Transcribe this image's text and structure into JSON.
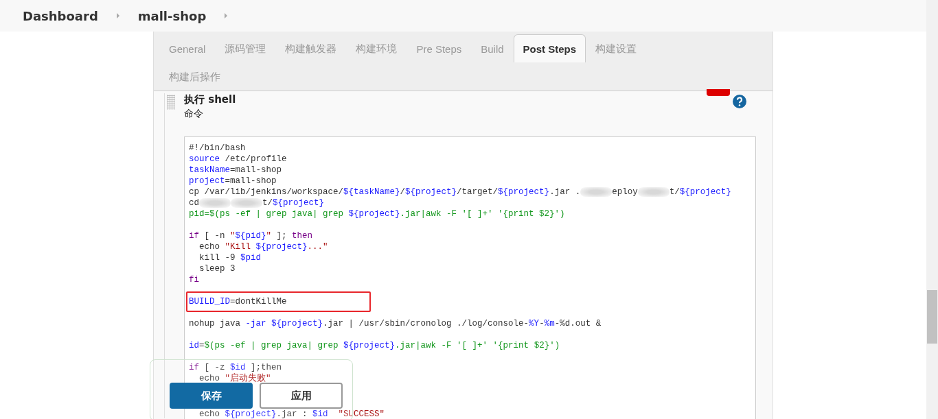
{
  "breadcrumbs": [
    {
      "label": "Dashboard"
    },
    {
      "label": "mall-shop"
    }
  ],
  "tabs": [
    {
      "label": "General",
      "selected": false
    },
    {
      "label": "源码管理",
      "selected": false
    },
    {
      "label": "构建触发器",
      "selected": false
    },
    {
      "label": "构建环境",
      "selected": false
    },
    {
      "label": "Pre Steps",
      "selected": false
    },
    {
      "label": "Build",
      "selected": false
    },
    {
      "label": "Post Steps",
      "selected": true
    },
    {
      "label": "构建设置",
      "selected": false
    },
    {
      "label": "构建后操作",
      "selected": false
    }
  ],
  "section": {
    "title": "执行 shell",
    "field_label": "命令"
  },
  "code_lines": [
    {
      "blank_before": false,
      "highlighted": false,
      "tokens": [
        {
          "kind": "plain",
          "text": "#!/bin/bash"
        }
      ]
    },
    {
      "blank_before": false,
      "highlighted": false,
      "tokens": [
        {
          "kind": "var",
          "text": "source"
        },
        {
          "kind": "plain",
          "text": " /etc/profile"
        }
      ]
    },
    {
      "blank_before": false,
      "highlighted": false,
      "tokens": [
        {
          "kind": "var",
          "text": "taskName"
        },
        {
          "kind": "plain",
          "text": "=mall-shop"
        }
      ]
    },
    {
      "blank_before": false,
      "highlighted": false,
      "tokens": [
        {
          "kind": "var",
          "text": "project"
        },
        {
          "kind": "plain",
          "text": "=mall-shop"
        }
      ]
    },
    {
      "blank_before": false,
      "highlighted": false,
      "tokens": [
        {
          "kind": "plain",
          "text": "cp /var/lib/jenkins/workspace/"
        },
        {
          "kind": "var",
          "text": "${taskName}"
        },
        {
          "kind": "plain",
          "text": "/"
        },
        {
          "kind": "var",
          "text": "${project}"
        },
        {
          "kind": "plain",
          "text": "/target/"
        },
        {
          "kind": "var",
          "text": "${project}"
        },
        {
          "kind": "plain",
          "text": ".jar ."
        },
        {
          "kind": "redacted"
        },
        {
          "kind": "plain",
          "text": "eploy"
        },
        {
          "kind": "redacted"
        },
        {
          "kind": "plain",
          "text": "t/"
        },
        {
          "kind": "var",
          "text": "${project}"
        }
      ]
    },
    {
      "blank_before": false,
      "highlighted": false,
      "tokens": [
        {
          "kind": "plain",
          "text": "cd"
        },
        {
          "kind": "redacted"
        },
        {
          "kind": "redacted"
        },
        {
          "kind": "plain",
          "text": "t/"
        },
        {
          "kind": "var",
          "text": "${project}"
        }
      ]
    },
    {
      "blank_before": false,
      "highlighted": false,
      "tokens": [
        {
          "kind": "sub",
          "text": "pid=$(ps -ef | grep java| grep "
        },
        {
          "kind": "var",
          "text": "${project}"
        },
        {
          "kind": "sub",
          "text": ".jar|awk -F '[ ]+' '{print $2}')"
        }
      ]
    },
    {
      "blank_before": true,
      "highlighted": false,
      "tokens": [
        {
          "kind": "kw",
          "text": "if"
        },
        {
          "kind": "plain",
          "text": " [ -n "
        },
        {
          "kind": "str",
          "text": "\""
        },
        {
          "kind": "var",
          "text": "${pid}"
        },
        {
          "kind": "str",
          "text": "\""
        },
        {
          "kind": "plain",
          "text": " ]; "
        },
        {
          "kind": "kw",
          "text": "then"
        }
      ]
    },
    {
      "blank_before": false,
      "highlighted": false,
      "tokens": [
        {
          "kind": "plain",
          "text": "  echo "
        },
        {
          "kind": "str",
          "text": "\"Kill "
        },
        {
          "kind": "var",
          "text": "${project}"
        },
        {
          "kind": "str",
          "text": "...\""
        }
      ]
    },
    {
      "blank_before": false,
      "highlighted": false,
      "tokens": [
        {
          "kind": "plain",
          "text": "  kill -9 "
        },
        {
          "kind": "var",
          "text": "$pid"
        }
      ]
    },
    {
      "blank_before": false,
      "highlighted": false,
      "tokens": [
        {
          "kind": "plain",
          "text": "  sleep 3"
        }
      ]
    },
    {
      "blank_before": false,
      "highlighted": false,
      "tokens": [
        {
          "kind": "kw",
          "text": "fi"
        }
      ]
    },
    {
      "blank_before": true,
      "highlighted": true,
      "tokens": [
        {
          "kind": "var",
          "text": "BUILD_ID"
        },
        {
          "kind": "plain",
          "text": "=dontKillMe"
        }
      ]
    },
    {
      "blank_before": true,
      "highlighted": false,
      "tokens": [
        {
          "kind": "plain",
          "text": "nohup java "
        },
        {
          "kind": "var",
          "text": "-jar "
        },
        {
          "kind": "var",
          "text": "${project}"
        },
        {
          "kind": "plain",
          "text": ".jar | /usr/sbin/cronolog ./log/console-"
        },
        {
          "kind": "var",
          "text": "%Y"
        },
        {
          "kind": "plain",
          "text": "-"
        },
        {
          "kind": "var",
          "text": "%m"
        },
        {
          "kind": "plain",
          "text": "-%d.out &"
        }
      ]
    },
    {
      "blank_before": true,
      "highlighted": false,
      "tokens": [
        {
          "kind": "var",
          "text": "id"
        },
        {
          "kind": "plain",
          "text": "="
        },
        {
          "kind": "sub",
          "text": "$(ps -ef | grep java| grep "
        },
        {
          "kind": "var",
          "text": "${project}"
        },
        {
          "kind": "sub",
          "text": ".jar|awk -F '[ ]+' '{print $2}')"
        }
      ]
    },
    {
      "blank_before": true,
      "highlighted": false,
      "tokens": [
        {
          "kind": "kw",
          "text": "if"
        },
        {
          "kind": "plain",
          "text": " [ -z "
        },
        {
          "kind": "var",
          "text": "$id"
        },
        {
          "kind": "plain",
          "text": " ];then"
        }
      ]
    },
    {
      "blank_before": false,
      "highlighted": false,
      "tokens": [
        {
          "kind": "plain",
          "text": "  echo "
        },
        {
          "kind": "str",
          "text": "\"启动失败\""
        }
      ]
    },
    {
      "blank_before": true,
      "highlighted": false,
      "tokens": [
        {
          "kind": "plain",
          "text": "  echo "
        },
        {
          "kind": "var",
          "text": "${project}"
        },
        {
          "kind": "plain",
          "text": ".jar : "
        },
        {
          "kind": "var",
          "text": "$id"
        },
        {
          "kind": "str",
          "text": "  \"SUCCESS\""
        }
      ]
    }
  ],
  "buttons": [
    {
      "label": "保存",
      "kind": "primary"
    },
    {
      "label": "应用",
      "kind": "secondary"
    }
  ]
}
